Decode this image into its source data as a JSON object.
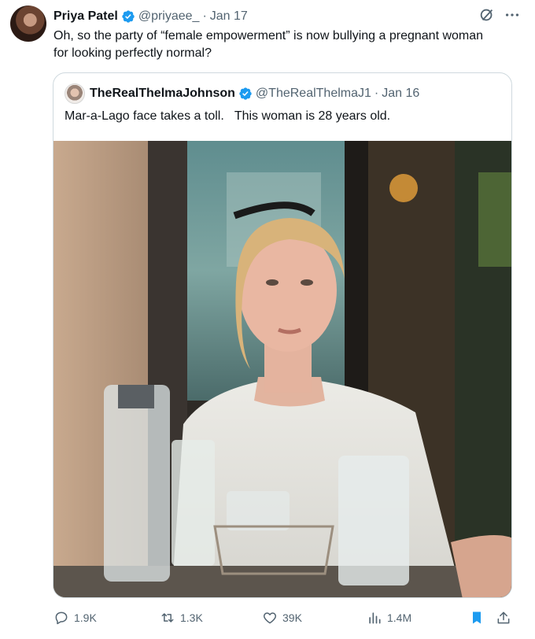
{
  "tweet": {
    "author_name": "Priya Patel",
    "author_handle": "@priyaee_",
    "separator": "·",
    "date": "Jan 17",
    "text": "Oh, so the party of “female empowerment” is now bullying a pregnant woman for looking perfectly normal?"
  },
  "quote": {
    "author_name": "TheRealThelmaJohnson",
    "author_handle": "@TheRealThelmaJ1",
    "separator": "·",
    "date": "Jan 16",
    "text": "Mar-a-Lago face takes a toll.   This woman is 28 years old.",
    "photo": "woman with sunglasses on head seated at restaurant table with water carafe and glasses"
  },
  "actions": {
    "replies": "1.9K",
    "reposts": "1.3K",
    "likes": "39K",
    "views": "1.4M"
  },
  "icons": {
    "verified": "verified-badge-icon",
    "grok": "grok-icon",
    "more": "more-icon",
    "reply": "reply-icon",
    "repost": "repost-icon",
    "like": "heart-icon",
    "views": "views-icon",
    "bookmark": "bookmark-icon",
    "share": "share-icon"
  },
  "colors": {
    "verified": "#1d9bf0",
    "bookmark_active": "#1d9bf0",
    "muted_text": "#536471",
    "border": "#cfd9de"
  }
}
